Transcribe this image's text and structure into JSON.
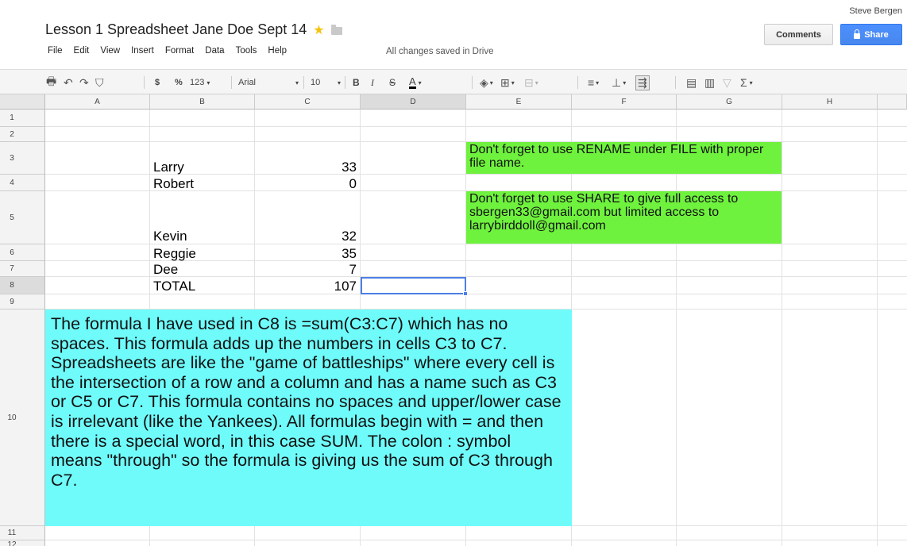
{
  "user": {
    "name": "Steve Bergen"
  },
  "document": {
    "title": "Lesson 1 Spreadsheet Jane Doe Sept 14",
    "save_status": "All changes saved in Drive"
  },
  "buttons": {
    "comments": "Comments",
    "share": "Share"
  },
  "menu": [
    "File",
    "Edit",
    "View",
    "Insert",
    "Format",
    "Data",
    "Tools",
    "Help"
  ],
  "toolbar": {
    "currency": "$",
    "percent": "%",
    "more_formats": "123",
    "font_family": "Arial",
    "font_size": "10",
    "bold": "B",
    "italic": "I",
    "strikethrough": "S",
    "text_color": "A",
    "functions": "Σ"
  },
  "columns": [
    "A",
    "B",
    "C",
    "D",
    "E",
    "F",
    "G",
    "H"
  ],
  "rows": [
    "1",
    "2",
    "3",
    "4",
    "5",
    "6",
    "7",
    "8",
    "9",
    "10",
    "11",
    "12"
  ],
  "selected_cell": "D8",
  "data": {
    "B3": "Larry",
    "C3": "33",
    "B4": "Robert",
    "C4": "0",
    "B5": "Kevin",
    "C5": "32",
    "B6": "Reggie",
    "C6": "35",
    "B7": "Dee",
    "C7": "7",
    "B8": "TOTAL",
    "C8": "107"
  },
  "notes": {
    "rename": "Don't forget to use RENAME under FILE with proper file name.",
    "share": "Don't forget to use SHARE to give full access to sbergen33@gmail.com but limited access to larrybirddoll@gmail.com",
    "formula": "The formula I have used in C8 is =sum(C3:C7) which has no spaces. This formula adds up the numbers in cells C3 to C7. Spreadsheets are like the \"game of battleships\" where every cell is the intersection of a row and a column and has a name such as C3 or C5 or C7. This formula contains no spaces and upper/lower case is irrelevant (like the Yankees). All formulas begin with = and then there is a special word, in this case SUM. The colon : symbol means \"through\" so the formula is giving us the sum of C3 through C7."
  },
  "colors": {
    "green_note": "#6ff23e",
    "cyan_note": "#70fbfb",
    "share_button": "#4d90fe",
    "star": "#f4c20d"
  }
}
